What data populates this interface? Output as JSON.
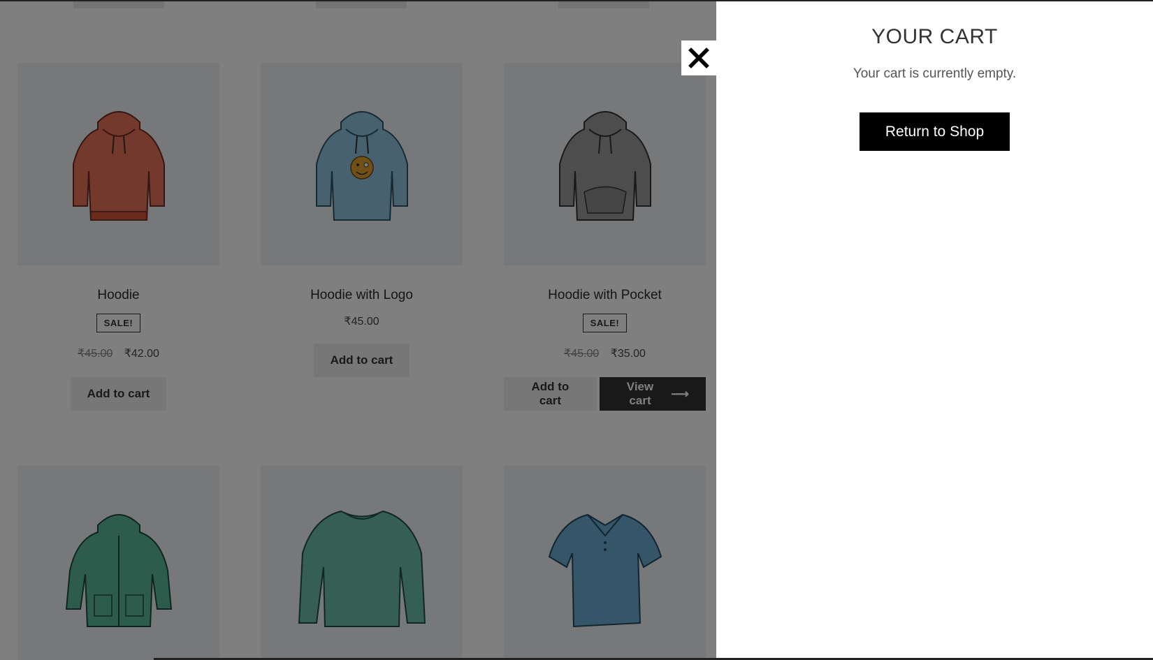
{
  "products_row1": [
    {
      "title": "Hoodie",
      "sale_badge": "SALE!",
      "old_price": "₹45.00",
      "price": "₹42.00",
      "add_label": "Add to cart",
      "color": "#e8735a"
    },
    {
      "title": "Hoodie with Logo",
      "price": "₹45.00",
      "add_label": "Add to cart",
      "color": "#8fc3dd"
    },
    {
      "title": "Hoodie with Pocket",
      "sale_badge": "SALE!",
      "old_price": "₹45.00",
      "price": "₹35.00",
      "add_label": "Add to cart",
      "view_cart_label": "View cart",
      "color": "#9a9a9a"
    }
  ],
  "products_row2_colors": [
    "#5bb89a",
    "#6cbfa7",
    "#6aaad0"
  ],
  "cart": {
    "title": "YOUR CART",
    "empty_message": "Your cart is currently empty.",
    "return_label": "Return to Shop"
  },
  "icons": {
    "close": "close-icon",
    "arrow": "arrow-right-icon"
  }
}
